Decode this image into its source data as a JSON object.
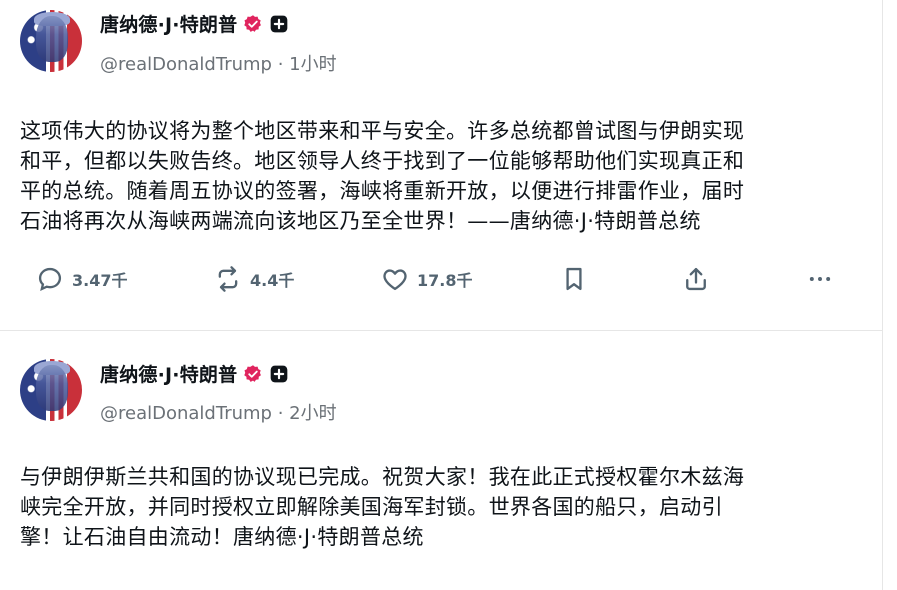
{
  "posts": [
    {
      "author_name": "唐纳德·J·特朗普",
      "handle": "@realDonaldTrump",
      "time": "· 1小时",
      "lines": [
        "这项伟大的协议将为整个地区带来和平与安全。许多总统都曾试图与伊朗实现",
        "和平，但都以失败告终。地区领导人终于找到了一位能够帮助他们实现真正和",
        "平的总统。随着周五协议的签署，海峡将重新开放，以便进行排雷作业，届时",
        "石油将再次从海峡两端流向该地区乃至全世界！——唐纳德·J·特朗普总统"
      ],
      "replies": "3.47千",
      "reposts": "4.4千",
      "likes": "17.8千"
    },
    {
      "author_name": "唐纳德·J·特朗普",
      "handle": "@realDonaldTrump",
      "time": "· 2小时",
      "lines": [
        "与伊朗伊斯兰共和国的协议现已完成。祝贺大家！我在此正式授权霍尔木兹海",
        "峡完全开放，并同时授权立即解除美国海军封锁。世界各国的船只，启动引",
        "擎！让石油自由流动！唐纳德·J·特朗普总统"
      ]
    }
  ],
  "icons": {
    "verified": "verified-badge-icon",
    "plus": "plus-badge-icon",
    "reply": "reply-icon",
    "repost": "repost-icon",
    "like": "heart-icon",
    "bookmark": "bookmark-icon",
    "share": "share-icon",
    "more": "more-icon"
  },
  "colors": {
    "verified": "#e0245e",
    "text": "#0f1419",
    "muted": "#536471"
  }
}
